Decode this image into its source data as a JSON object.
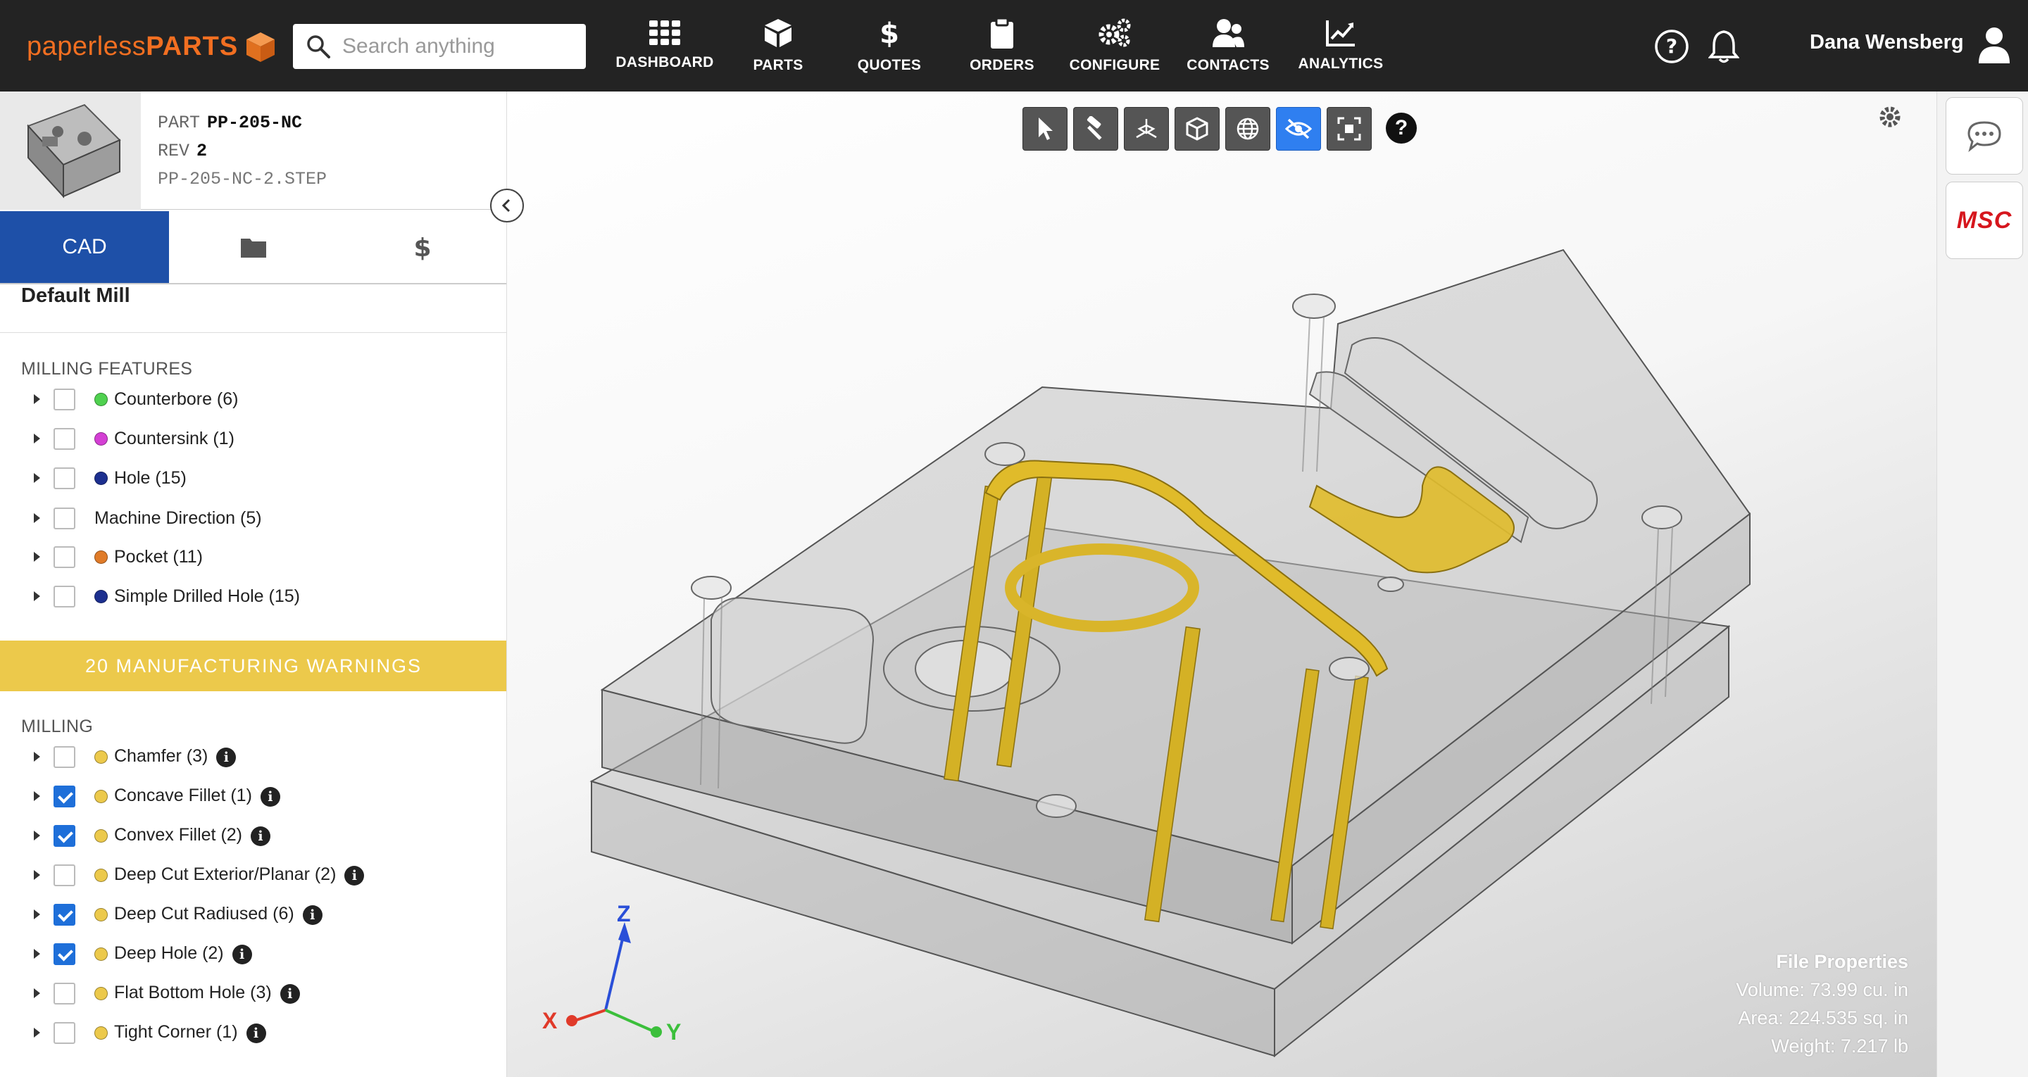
{
  "brand": {
    "part1": "paperless",
    "part2": "PARTS",
    "color": "#f26f21"
  },
  "search": {
    "placeholder": "Search anything"
  },
  "nav": [
    {
      "label": "DASHBOARD",
      "icon": "grid-icon"
    },
    {
      "label": "PARTS",
      "icon": "cube-icon"
    },
    {
      "label": "QUOTES",
      "icon": "dollar-icon"
    },
    {
      "label": "ORDERS",
      "icon": "clipboard-icon"
    },
    {
      "label": "CONFIGURE",
      "icon": "gears-icon"
    },
    {
      "label": "CONTACTS",
      "icon": "users-icon"
    },
    {
      "label": "ANALYTICS",
      "icon": "chart-icon"
    }
  ],
  "user": {
    "name": "Dana Wensberg"
  },
  "part": {
    "part_key": "PART",
    "part_value": "PP-205-NC",
    "rev_key": "REV",
    "rev_value": "2",
    "filename": "PP-205-NC-2.STEP"
  },
  "tabs": {
    "cad": "CAD",
    "files_icon": "folder-icon",
    "pricing_icon": "dollar-icon"
  },
  "process": {
    "title": "Default Mill"
  },
  "milling_features": {
    "title": "MILLING FEATURES",
    "items": [
      {
        "label": "Counterbore (6)",
        "color": "#4fd14f",
        "checked": false
      },
      {
        "label": "Countersink (1)",
        "color": "#d43fd4",
        "checked": false
      },
      {
        "label": "Hole (15)",
        "color": "#1c2f8f",
        "checked": false
      },
      {
        "label": "Machine Direction (5)",
        "color": "",
        "checked": false
      },
      {
        "label": "Pocket (11)",
        "color": "#e07b28",
        "checked": false
      },
      {
        "label": "Simple Drilled Hole (15)",
        "color": "#1c2f8f",
        "checked": false
      }
    ]
  },
  "warnings": {
    "banner": "20 MANUFACTURING WARNINGS",
    "color": "#ecc94b",
    "group": "MILLING",
    "items": [
      {
        "label": "Chamfer (3)",
        "checked": false
      },
      {
        "label": "Concave Fillet (1)",
        "checked": true
      },
      {
        "label": "Convex Fillet (2)",
        "checked": true
      },
      {
        "label": "Deep Cut Exterior/Planar (2)",
        "checked": false
      },
      {
        "label": "Deep Cut Radiused (6)",
        "checked": true
      },
      {
        "label": "Deep Hole (2)",
        "checked": true
      },
      {
        "label": "Flat Bottom Hole (3)",
        "checked": false
      },
      {
        "label": "Tight Corner (1)",
        "checked": false
      }
    ]
  },
  "viewer_tools": [
    {
      "icon": "pointer-icon",
      "active": false
    },
    {
      "icon": "hammer-icon",
      "active": false
    },
    {
      "icon": "axes-icon",
      "active": false
    },
    {
      "icon": "box-icon",
      "active": false
    },
    {
      "icon": "globe-icon",
      "active": false
    },
    {
      "icon": "eye-slash-icon",
      "active": true
    },
    {
      "icon": "focus-icon",
      "active": false
    }
  ],
  "axes": {
    "x": "X",
    "y": "Y",
    "z": "Z"
  },
  "file_properties": {
    "title": "File Properties",
    "volume": "Volume: 73.99 cu. in",
    "area": "Area: 224.535 sq. in",
    "weight": "Weight: 7.217 lb"
  },
  "rail": {
    "chat_icon": "chat-icon",
    "msc_label": "MSC"
  }
}
